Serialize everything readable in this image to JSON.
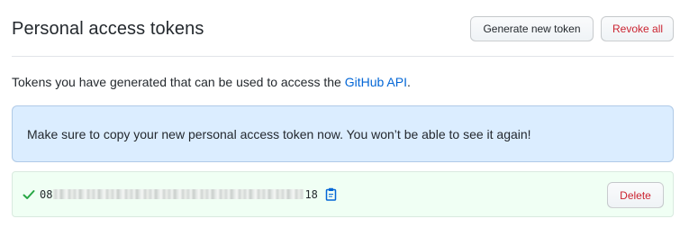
{
  "header": {
    "title": "Personal access tokens",
    "generate_label": "Generate new token",
    "revoke_label": "Revoke all"
  },
  "intro": {
    "text_before": "Tokens you have generated that can be used to access the ",
    "link_text": "GitHub API",
    "text_after": "."
  },
  "flash": {
    "message": "Make sure to copy your new personal access token now. You won’t be able to see it again!"
  },
  "token": {
    "prefix": "08",
    "suffix": "18",
    "status_icon": "check-icon",
    "copy_icon": "clipboard-icon",
    "delete_label": "Delete"
  },
  "colors": {
    "link": "#0366d6",
    "danger": "#cb2431",
    "flash_bg": "#dbedff",
    "token_row_bg": "#f0fff4",
    "success": "#28a745"
  }
}
